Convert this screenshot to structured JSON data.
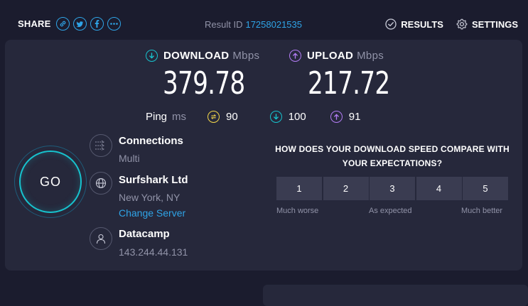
{
  "share": {
    "label": "SHARE",
    "icons": [
      "link-icon",
      "twitter-icon",
      "facebook-icon",
      "more-icon"
    ]
  },
  "result": {
    "label": "Result ID",
    "id": "17258021535"
  },
  "nav": {
    "results": "RESULTS",
    "settings": "SETTINGS"
  },
  "download": {
    "label": "DOWNLOAD",
    "unit": "Mbps",
    "value": "379.78",
    "color": "#17c3ce"
  },
  "upload": {
    "label": "UPLOAD",
    "unit": "Mbps",
    "value": "217.72",
    "color": "#b27cf4"
  },
  "ping": {
    "label": "Ping",
    "unit": "ms",
    "idle": "90",
    "download": "100",
    "upload": "91",
    "idle_color": "#f5d84a"
  },
  "go_label": "GO",
  "connections": {
    "title": "Connections",
    "value": "Multi"
  },
  "server": {
    "name": "Surfshark Ltd",
    "location": "New York, NY",
    "change": "Change Server"
  },
  "provider": {
    "name": "Datacamp",
    "ip": "143.244.44.131"
  },
  "compare": {
    "question": "HOW DOES YOUR DOWNLOAD SPEED COMPARE WITH YOUR EXPECTATIONS?",
    "options": [
      "1",
      "2",
      "3",
      "4",
      "5"
    ],
    "low": "Much worse",
    "mid": "As expected",
    "high": "Much better"
  }
}
